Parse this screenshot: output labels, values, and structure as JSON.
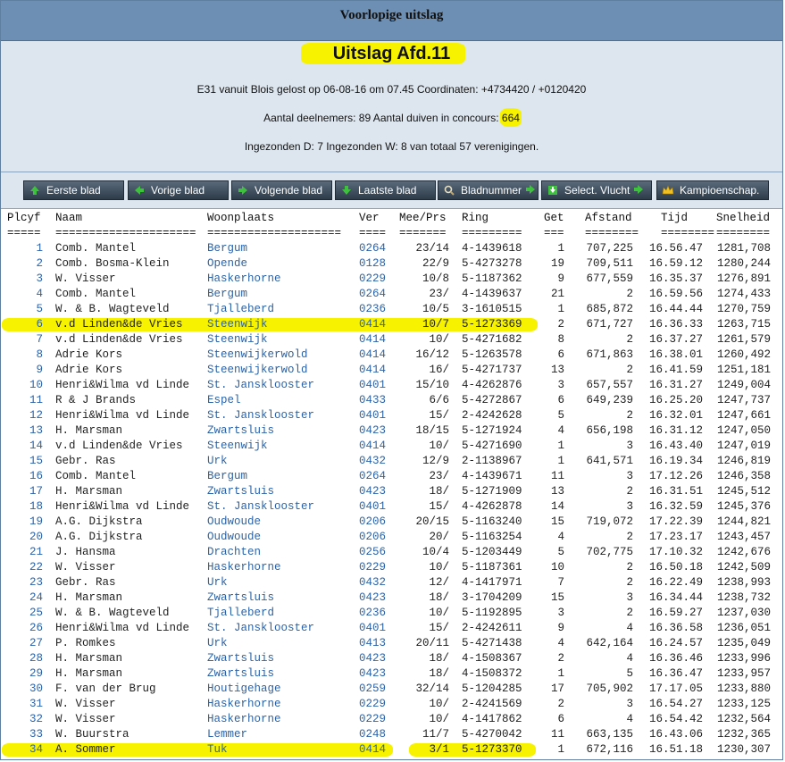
{
  "header": {
    "title": "Voorlopige uitslag"
  },
  "info": {
    "title": "Uitslag Afd.11",
    "line1": "E31 vanuit Blois gelost op 06-08-16 om 07.45 Coordinaten: +4734420 / +0120420",
    "line2_prefix": "Aantal deelnemers: 89 Aantal duiven in concours: ",
    "line2_value": "664",
    "line3": "Ingezonden D: 7 Ingezonden W: 8 van totaal 57 verenigingen."
  },
  "buttons": [
    {
      "label": "Eerste blad",
      "icon": "arrow-up-icon"
    },
    {
      "label": "Vorige blad",
      "icon": "arrow-left-icon"
    },
    {
      "label": "Volgende blad",
      "icon": "arrow-right-icon"
    },
    {
      "label": "Laatste blad",
      "icon": "arrow-down-icon"
    },
    {
      "label": "Bladnummer",
      "icon": "magnifier-icon"
    },
    {
      "label": "Select. Vlucht",
      "icon": "download-icon"
    },
    {
      "label": "Kampioenschap.",
      "icon": "crown-icon"
    }
  ],
  "table": {
    "headers": [
      "Plcyf",
      "Naam",
      "Woonplaats",
      "Ver",
      "Mee/Prs",
      "Ring",
      "Get",
      "Afstand",
      "Tijd",
      "Snelheid"
    ],
    "underlines": [
      "=====",
      "=====================",
      "====================",
      "====",
      "=======",
      "=========",
      "===",
      "========",
      "========",
      "========"
    ],
    "rows": [
      [
        "1",
        "Comb. Mantel",
        "Bergum",
        "0264",
        "23/14",
        "4-1439618",
        "1",
        "707,225",
        "16.56.47",
        "1281,708"
      ],
      [
        "2",
        "Comb. Bosma-Klein",
        "Opende",
        "0128",
        "22/9",
        "5-4273278",
        "19",
        "709,511",
        "16.59.12",
        "1280,244"
      ],
      [
        "3",
        "W. Visser",
        "Haskerhorne",
        "0229",
        "10/8",
        "5-1187362",
        "9",
        "677,559",
        "16.35.37",
        "1276,891"
      ],
      [
        "4",
        "Comb. Mantel",
        "Bergum",
        "0264",
        "23/",
        "4-1439637",
        "21",
        "2",
        "16.59.56",
        "1274,433"
      ],
      [
        "5",
        "W. & B. Wagteveld",
        "Tjalleberd",
        "0236",
        "10/5",
        "3-1610515",
        "1",
        "685,872",
        "16.44.44",
        "1270,759"
      ],
      [
        "6",
        "v.d Linden&de Vries",
        "Steenwijk",
        "0414",
        "10/7",
        "5-1273369",
        "2",
        "671,727",
        "16.36.33",
        "1263,715"
      ],
      [
        "7",
        "v.d Linden&de Vries",
        "Steenwijk",
        "0414",
        "10/",
        "5-4271682",
        "8",
        "2",
        "16.37.27",
        "1261,579"
      ],
      [
        "8",
        "Adrie Kors",
        "Steenwijkerwold",
        "0414",
        "16/12",
        "5-1263578",
        "6",
        "671,863",
        "16.38.01",
        "1260,492"
      ],
      [
        "9",
        "Adrie Kors",
        "Steenwijkerwold",
        "0414",
        "16/",
        "5-4271737",
        "13",
        "2",
        "16.41.59",
        "1251,181"
      ],
      [
        "10",
        "Henri&Wilma vd Linde",
        "St. Jansklooster",
        "0401",
        "15/10",
        "4-4262876",
        "3",
        "657,557",
        "16.31.27",
        "1249,004"
      ],
      [
        "11",
        "R & J Brands",
        "Espel",
        "0433",
        "6/6",
        "5-4272867",
        "6",
        "649,239",
        "16.25.20",
        "1247,737"
      ],
      [
        "12",
        "Henri&Wilma vd Linde",
        "St. Jansklooster",
        "0401",
        "15/",
        "2-4242628",
        "5",
        "2",
        "16.32.01",
        "1247,661"
      ],
      [
        "13",
        "H. Marsman",
        "Zwartsluis",
        "0423",
        "18/15",
        "5-1271924",
        "4",
        "656,198",
        "16.31.12",
        "1247,050"
      ],
      [
        "14",
        "v.d Linden&de Vries",
        "Steenwijk",
        "0414",
        "10/",
        "5-4271690",
        "1",
        "3",
        "16.43.40",
        "1247,019"
      ],
      [
        "15",
        "Gebr. Ras",
        "Urk",
        "0432",
        "12/9",
        "2-1138967",
        "1",
        "641,571",
        "16.19.34",
        "1246,819"
      ],
      [
        "16",
        "Comb. Mantel",
        "Bergum",
        "0264",
        "23/",
        "4-1439671",
        "11",
        "3",
        "17.12.26",
        "1246,358"
      ],
      [
        "17",
        "H. Marsman",
        "Zwartsluis",
        "0423",
        "18/",
        "5-1271909",
        "13",
        "2",
        "16.31.51",
        "1245,512"
      ],
      [
        "18",
        "Henri&Wilma vd Linde",
        "St. Jansklooster",
        "0401",
        "15/",
        "4-4262878",
        "14",
        "3",
        "16.32.59",
        "1245,376"
      ],
      [
        "19",
        "A.G. Dijkstra",
        "Oudwoude",
        "0206",
        "20/15",
        "5-1163240",
        "15",
        "719,072",
        "17.22.39",
        "1244,821"
      ],
      [
        "20",
        "A.G. Dijkstra",
        "Oudwoude",
        "0206",
        "20/",
        "5-1163254",
        "4",
        "2",
        "17.23.17",
        "1243,457"
      ],
      [
        "21",
        "J. Hansma",
        "Drachten",
        "0256",
        "10/4",
        "5-1203449",
        "5",
        "702,775",
        "17.10.32",
        "1242,676"
      ],
      [
        "22",
        "W. Visser",
        "Haskerhorne",
        "0229",
        "10/",
        "5-1187361",
        "10",
        "2",
        "16.50.18",
        "1242,509"
      ],
      [
        "23",
        "Gebr. Ras",
        "Urk",
        "0432",
        "12/",
        "4-1417971",
        "7",
        "2",
        "16.22.49",
        "1238,993"
      ],
      [
        "24",
        "H. Marsman",
        "Zwartsluis",
        "0423",
        "18/",
        "3-1704209",
        "15",
        "3",
        "16.34.44",
        "1238,732"
      ],
      [
        "25",
        "W. & B. Wagteveld",
        "Tjalleberd",
        "0236",
        "10/",
        "5-1192895",
        "3",
        "2",
        "16.59.27",
        "1237,030"
      ],
      [
        "26",
        "Henri&Wilma vd Linde",
        "St. Jansklooster",
        "0401",
        "15/",
        "2-4242611",
        "9",
        "4",
        "16.36.58",
        "1236,051"
      ],
      [
        "27",
        "P. Romkes",
        "Urk",
        "0413",
        "20/11",
        "5-4271438",
        "4",
        "642,164",
        "16.24.57",
        "1235,049"
      ],
      [
        "28",
        "H. Marsman",
        "Zwartsluis",
        "0423",
        "18/",
        "4-1508367",
        "2",
        "4",
        "16.36.46",
        "1233,996"
      ],
      [
        "29",
        "H. Marsman",
        "Zwartsluis",
        "0423",
        "18/",
        "4-1508372",
        "1",
        "5",
        "16.36.47",
        "1233,957"
      ],
      [
        "30",
        "F. van der Brug",
        "Houtigehage",
        "0259",
        "32/14",
        "5-1204285",
        "17",
        "705,902",
        "17.17.05",
        "1233,880"
      ],
      [
        "31",
        "W. Visser",
        "Haskerhorne",
        "0229",
        "10/",
        "2-4241569",
        "2",
        "3",
        "16.54.27",
        "1233,125"
      ],
      [
        "32",
        "W. Visser",
        "Haskerhorne",
        "0229",
        "10/",
        "4-1417862",
        "6",
        "4",
        "16.54.42",
        "1232,564"
      ],
      [
        "33",
        "W. Buurstra",
        "Lemmer",
        "0248",
        "11/7",
        "5-4270042",
        "11",
        "663,135",
        "16.43.06",
        "1232,365"
      ],
      [
        "34",
        "A. Sommer",
        "Tuk",
        "0414",
        "3/1",
        "5-1273370",
        "1",
        "672,116",
        "16.51.18",
        "1230,307"
      ]
    ]
  },
  "colors": {
    "header_bg": "#6d8fb4",
    "panel_bg": "#dde6ee",
    "link": "#2b63a8",
    "highlight": "#f6f200",
    "button": "#2d3b49"
  }
}
